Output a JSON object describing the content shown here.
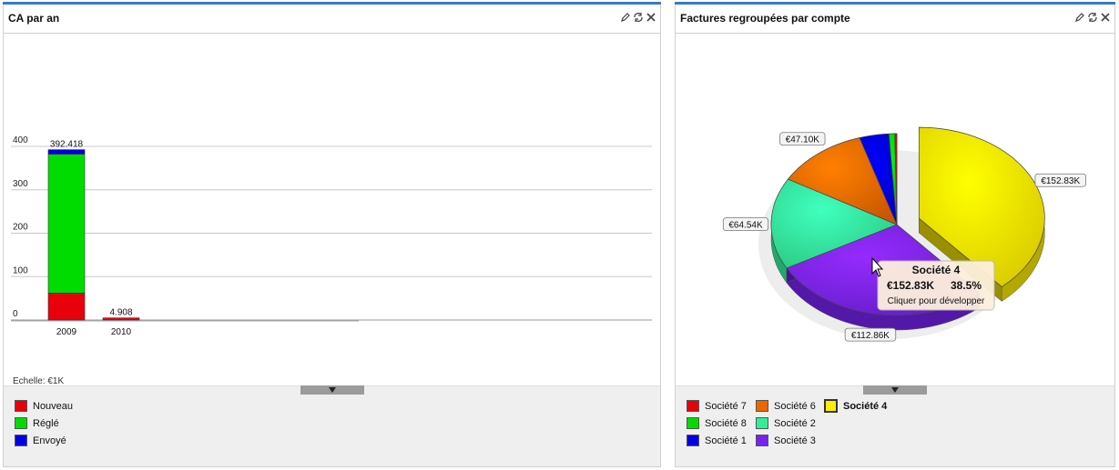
{
  "left_panel": {
    "title": "CA par an",
    "scale_note": "Echelle: €1K",
    "legend": [
      {
        "label": "Nouveau",
        "color": "#e8000b"
      },
      {
        "label": "Réglé",
        "color": "#00dc00"
      },
      {
        "label": "Envoyé",
        "color": "#0000e6"
      }
    ]
  },
  "right_panel": {
    "title": "Factures regroupées par compte",
    "legend": [
      {
        "label": "Société 7",
        "color": "#e8000b"
      },
      {
        "label": "Société 6",
        "color": "#ee6600"
      },
      {
        "label": "Société 4",
        "color": "#ffee00",
        "selected": true
      },
      {
        "label": "Société 8",
        "color": "#00dc00"
      },
      {
        "label": "Société 2",
        "color": "#33ee99"
      },
      {
        "label": "Société 1",
        "color": "#0000e6"
      },
      {
        "label": "Société 3",
        "color": "#7722ee"
      }
    ],
    "tooltip": {
      "title": "Société 4",
      "value": "€152.83K",
      "percent": "38.5%",
      "hint": "Cliquer pour développer"
    }
  },
  "chart_data": [
    {
      "type": "bar",
      "stacked": true,
      "categories": [
        "2009",
        "2010"
      ],
      "series": [
        {
          "name": "Nouveau",
          "color": "#e8000b",
          "values": [
            62,
            4.9
          ]
        },
        {
          "name": "Réglé",
          "color": "#00dc00",
          "values": [
            320,
            0
          ]
        },
        {
          "name": "Envoyé",
          "color": "#0000e6",
          "values": [
            10.418,
            0
          ]
        }
      ],
      "totals": [
        "392.418",
        "4.908"
      ],
      "ylim": [
        0,
        400
      ],
      "yticks": [
        "0",
        "100",
        "200",
        "300",
        "400"
      ],
      "grid": true,
      "title": "CA par an"
    },
    {
      "type": "pie",
      "three_d": true,
      "slices": [
        {
          "name": "Société 4",
          "color": "#ffee00",
          "value": 152.83,
          "label": "€152.83K"
        },
        {
          "name": "Société 3",
          "color": "#7722ee",
          "value": 112.86,
          "label": "€112.86K"
        },
        {
          "name": "Société 2",
          "color": "#33ee99",
          "value": 64.54,
          "label": "€64.54K"
        },
        {
          "name": "Société 6",
          "color": "#ee6600",
          "value": 47.1,
          "label": "€47.10K"
        },
        {
          "name": "Société 1",
          "color": "#0000e6",
          "value": 15.0,
          "label": ""
        },
        {
          "name": "Société 8",
          "color": "#00dc00",
          "value": 3.0,
          "label": ""
        },
        {
          "name": "Société 7",
          "color": "#e8000b",
          "value": 1.0,
          "label": ""
        }
      ],
      "exploded": "Société 4",
      "title": "Factures regroupées par compte"
    }
  ]
}
